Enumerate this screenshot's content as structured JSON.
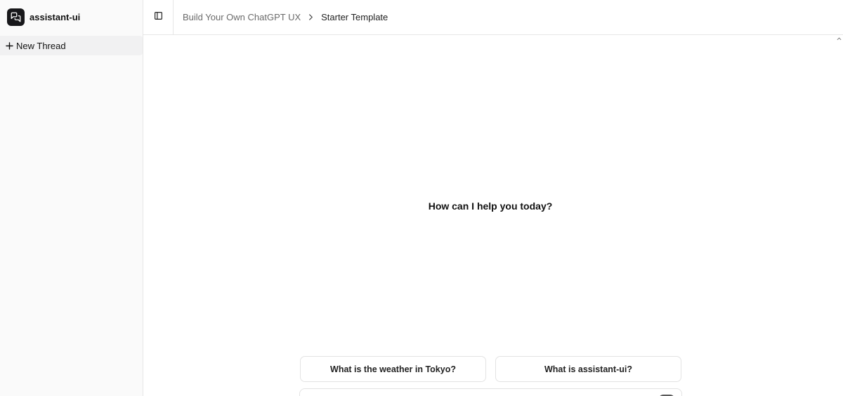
{
  "sidebar": {
    "brand_name": "assistant-ui",
    "new_thread_label": "New Thread",
    "icons": {
      "logo": "chat-bubbles-icon",
      "new_thread": "plus-icon"
    }
  },
  "header": {
    "breadcrumb": {
      "link": "Build Your Own ChatGPT UX",
      "current": "Starter Template"
    },
    "icons": {
      "toggle": "sidebar-toggle-icon",
      "separator": "chevron-right-icon"
    }
  },
  "main": {
    "greeting": "How can I help you today?",
    "suggestions": [
      {
        "label": "What is the weather in Tokyo?"
      },
      {
        "label": "What is assistant-ui?"
      }
    ]
  },
  "colors": {
    "sidebar_bg": "#fafafa",
    "logo_bg": "#18181b",
    "border": "#e6e6e6",
    "muted_text": "#6b6b6b"
  }
}
